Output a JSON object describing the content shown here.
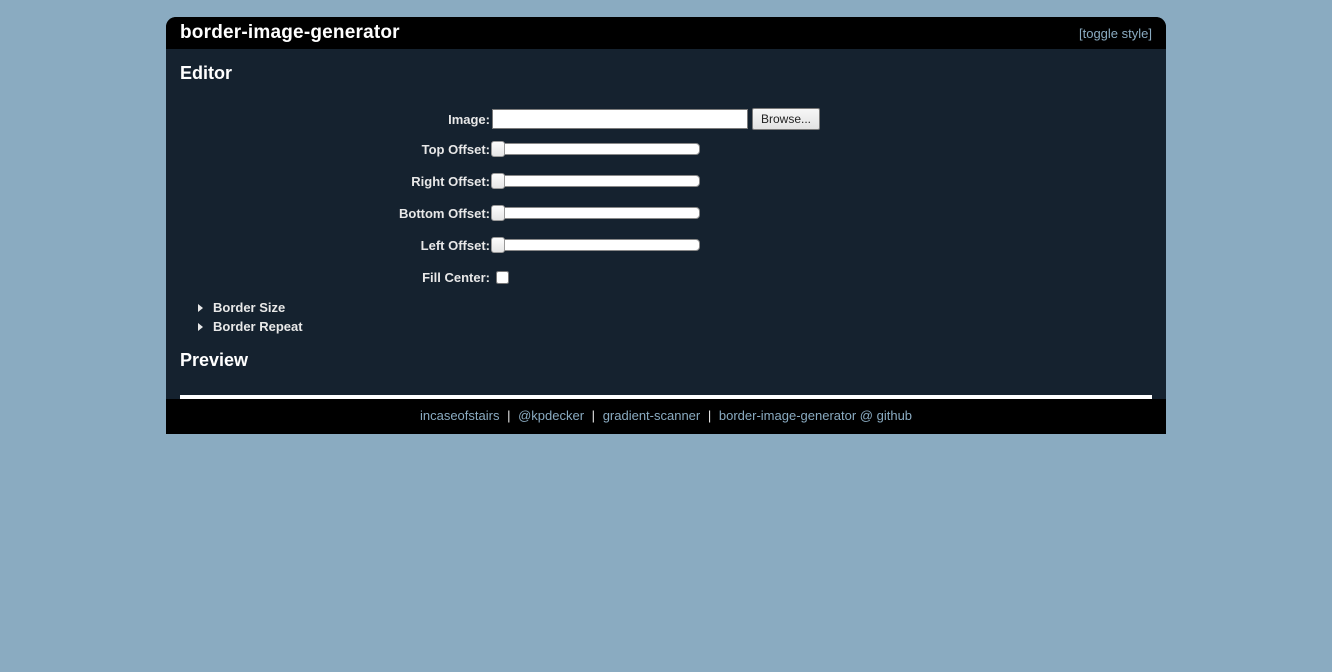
{
  "header": {
    "title": "border-image-generator",
    "toggle_style": "[toggle style]"
  },
  "editor": {
    "title": "Editor",
    "fields": {
      "image_label": "Image:",
      "browse_label": "Browse...",
      "top_offset_label": "Top Offset:",
      "right_offset_label": "Right Offset:",
      "bottom_offset_label": "Bottom Offset:",
      "left_offset_label": "Left Offset:",
      "fill_center_label": "Fill Center:",
      "image_value": "",
      "top_offset": 0,
      "right_offset": 0,
      "bottom_offset": 0,
      "left_offset": 0,
      "fill_center": false
    },
    "accordions": {
      "border_size": "Border Size",
      "border_repeat": "Border Repeat"
    }
  },
  "preview": {
    "title": "Preview"
  },
  "footer": {
    "links": {
      "incaseofstairs": "incaseofstairs",
      "kpdecker": "@kpdecker",
      "gradient_scanner": "gradient-scanner",
      "github": "border-image-generator @ github"
    },
    "sep": "|"
  }
}
